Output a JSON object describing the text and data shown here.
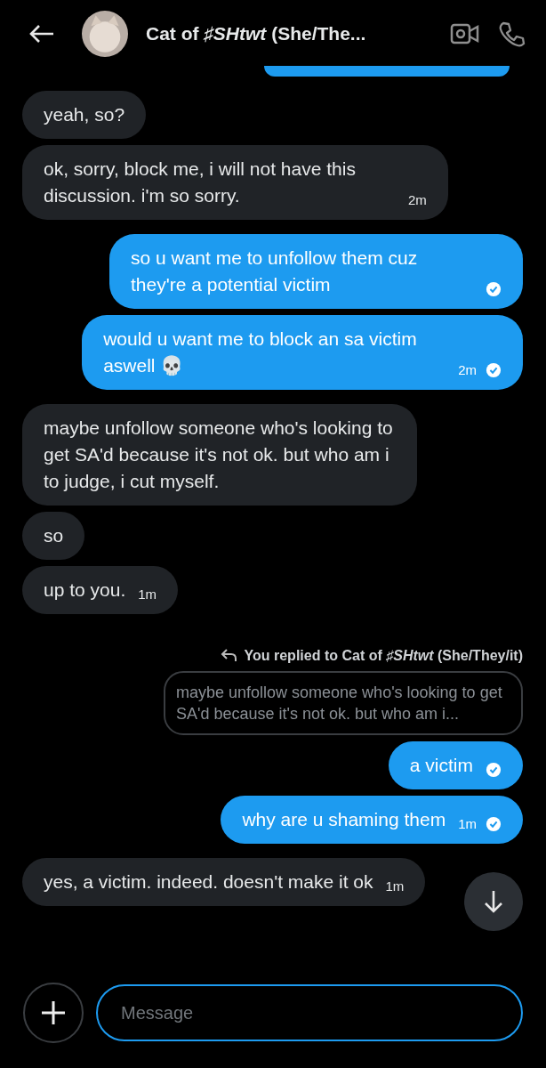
{
  "header": {
    "title": "Cat of *♯SHtwt* (She/The..."
  },
  "messages": [
    {
      "kind": "clipped"
    },
    {
      "kind": "text",
      "outgoing": false,
      "text": "yeah, so?"
    },
    {
      "kind": "text",
      "outgoing": false,
      "text": "ok, sorry, block me, i will not have this discussion. i'm so sorry.",
      "time": "2m"
    },
    {
      "kind": "text",
      "outgoing": true,
      "text": "so u want me to unfollow them cuz they're a potential victim",
      "read": true
    },
    {
      "kind": "text",
      "outgoing": true,
      "text": "would u want me to block an sa victim aswell 💀",
      "time": "2m",
      "read": true
    },
    {
      "kind": "text",
      "outgoing": false,
      "text": "maybe unfollow someone who's looking to get SA'd because it's not ok. but who am i to judge, i cut myself."
    },
    {
      "kind": "text",
      "outgoing": false,
      "text": "so"
    },
    {
      "kind": "text",
      "outgoing": false,
      "text": "up to you.",
      "time": "1m"
    },
    {
      "kind": "reply",
      "label": "You replied to Cat of *♯SHtwt* (She/They/it)",
      "quote": "maybe unfollow someone who's looking to get SA'd because it's not ok. but who am i..."
    },
    {
      "kind": "text",
      "outgoing": true,
      "text": "a victim",
      "read": true
    },
    {
      "kind": "text",
      "outgoing": true,
      "text": "why are u shaming them",
      "time": "1m",
      "read": true
    },
    {
      "kind": "text",
      "outgoing": false,
      "text": "yes, a victim. indeed. doesn't make it ok",
      "time": "1m"
    }
  ],
  "composer": {
    "placeholder": "Message"
  }
}
